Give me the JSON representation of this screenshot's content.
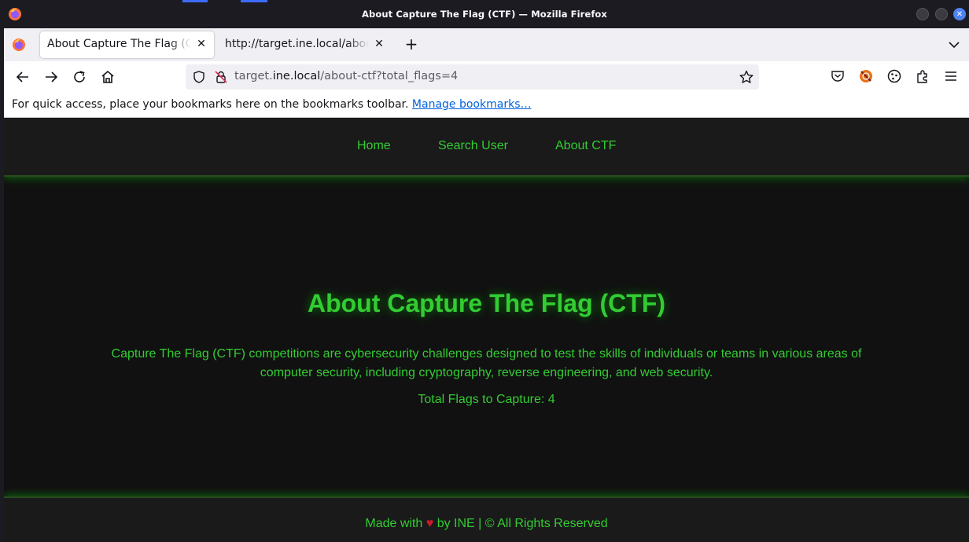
{
  "window": {
    "title": "About Capture The Flag (CTF) — Mozilla Firefox"
  },
  "tabs": [
    {
      "label": "About Capture The Flag (CTF)",
      "active": true
    },
    {
      "label": "http://target.ine.local/about-ctf",
      "active": false
    }
  ],
  "urlbar": {
    "scheme_prefix": "target.",
    "host": "ine.local",
    "path": "/about-ctf?total_flags=4"
  },
  "bookmarks_bar": {
    "message": "For quick access, place your bookmarks here on the bookmarks toolbar.",
    "link": "Manage bookmarks…"
  },
  "site": {
    "nav": [
      "Home",
      "Search User",
      "About CTF"
    ],
    "title": "About Capture The Flag (CTF)",
    "description": "Capture The Flag (CTF) competitions are cybersecurity challenges designed to test the skills of individuals or teams in various areas of computer security, including cryptography, reverse engineering, and web security.",
    "flags_text": "Total Flags to Capture: 4",
    "footer": {
      "before": "Made with",
      "after": "by INE | © All Rights Reserved",
      "heart_icon": "heart-icon"
    }
  },
  "colors": {
    "accent_green": "#33cc33",
    "page_bg": "#111111",
    "heart": "#d0192b",
    "link_blue": "#0061e0"
  }
}
